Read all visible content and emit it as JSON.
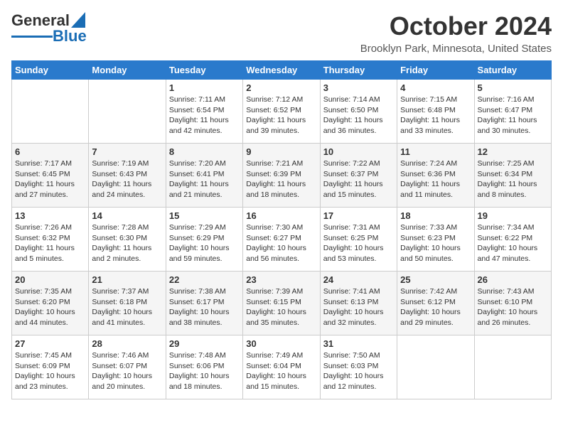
{
  "header": {
    "logo_general": "General",
    "logo_blue": "Blue",
    "month": "October 2024",
    "location": "Brooklyn Park, Minnesota, United States"
  },
  "weekdays": [
    "Sunday",
    "Monday",
    "Tuesday",
    "Wednesday",
    "Thursday",
    "Friday",
    "Saturday"
  ],
  "weeks": [
    [
      {
        "day": "",
        "info": ""
      },
      {
        "day": "",
        "info": ""
      },
      {
        "day": "1",
        "info": "Sunrise: 7:11 AM\nSunset: 6:54 PM\nDaylight: 11 hours and 42 minutes."
      },
      {
        "day": "2",
        "info": "Sunrise: 7:12 AM\nSunset: 6:52 PM\nDaylight: 11 hours and 39 minutes."
      },
      {
        "day": "3",
        "info": "Sunrise: 7:14 AM\nSunset: 6:50 PM\nDaylight: 11 hours and 36 minutes."
      },
      {
        "day": "4",
        "info": "Sunrise: 7:15 AM\nSunset: 6:48 PM\nDaylight: 11 hours and 33 minutes."
      },
      {
        "day": "5",
        "info": "Sunrise: 7:16 AM\nSunset: 6:47 PM\nDaylight: 11 hours and 30 minutes."
      }
    ],
    [
      {
        "day": "6",
        "info": "Sunrise: 7:17 AM\nSunset: 6:45 PM\nDaylight: 11 hours and 27 minutes."
      },
      {
        "day": "7",
        "info": "Sunrise: 7:19 AM\nSunset: 6:43 PM\nDaylight: 11 hours and 24 minutes."
      },
      {
        "day": "8",
        "info": "Sunrise: 7:20 AM\nSunset: 6:41 PM\nDaylight: 11 hours and 21 minutes."
      },
      {
        "day": "9",
        "info": "Sunrise: 7:21 AM\nSunset: 6:39 PM\nDaylight: 11 hours and 18 minutes."
      },
      {
        "day": "10",
        "info": "Sunrise: 7:22 AM\nSunset: 6:37 PM\nDaylight: 11 hours and 15 minutes."
      },
      {
        "day": "11",
        "info": "Sunrise: 7:24 AM\nSunset: 6:36 PM\nDaylight: 11 hours and 11 minutes."
      },
      {
        "day": "12",
        "info": "Sunrise: 7:25 AM\nSunset: 6:34 PM\nDaylight: 11 hours and 8 minutes."
      }
    ],
    [
      {
        "day": "13",
        "info": "Sunrise: 7:26 AM\nSunset: 6:32 PM\nDaylight: 11 hours and 5 minutes."
      },
      {
        "day": "14",
        "info": "Sunrise: 7:28 AM\nSunset: 6:30 PM\nDaylight: 11 hours and 2 minutes."
      },
      {
        "day": "15",
        "info": "Sunrise: 7:29 AM\nSunset: 6:29 PM\nDaylight: 10 hours and 59 minutes."
      },
      {
        "day": "16",
        "info": "Sunrise: 7:30 AM\nSunset: 6:27 PM\nDaylight: 10 hours and 56 minutes."
      },
      {
        "day": "17",
        "info": "Sunrise: 7:31 AM\nSunset: 6:25 PM\nDaylight: 10 hours and 53 minutes."
      },
      {
        "day": "18",
        "info": "Sunrise: 7:33 AM\nSunset: 6:23 PM\nDaylight: 10 hours and 50 minutes."
      },
      {
        "day": "19",
        "info": "Sunrise: 7:34 AM\nSunset: 6:22 PM\nDaylight: 10 hours and 47 minutes."
      }
    ],
    [
      {
        "day": "20",
        "info": "Sunrise: 7:35 AM\nSunset: 6:20 PM\nDaylight: 10 hours and 44 minutes."
      },
      {
        "day": "21",
        "info": "Sunrise: 7:37 AM\nSunset: 6:18 PM\nDaylight: 10 hours and 41 minutes."
      },
      {
        "day": "22",
        "info": "Sunrise: 7:38 AM\nSunset: 6:17 PM\nDaylight: 10 hours and 38 minutes."
      },
      {
        "day": "23",
        "info": "Sunrise: 7:39 AM\nSunset: 6:15 PM\nDaylight: 10 hours and 35 minutes."
      },
      {
        "day": "24",
        "info": "Sunrise: 7:41 AM\nSunset: 6:13 PM\nDaylight: 10 hours and 32 minutes."
      },
      {
        "day": "25",
        "info": "Sunrise: 7:42 AM\nSunset: 6:12 PM\nDaylight: 10 hours and 29 minutes."
      },
      {
        "day": "26",
        "info": "Sunrise: 7:43 AM\nSunset: 6:10 PM\nDaylight: 10 hours and 26 minutes."
      }
    ],
    [
      {
        "day": "27",
        "info": "Sunrise: 7:45 AM\nSunset: 6:09 PM\nDaylight: 10 hours and 23 minutes."
      },
      {
        "day": "28",
        "info": "Sunrise: 7:46 AM\nSunset: 6:07 PM\nDaylight: 10 hours and 20 minutes."
      },
      {
        "day": "29",
        "info": "Sunrise: 7:48 AM\nSunset: 6:06 PM\nDaylight: 10 hours and 18 minutes."
      },
      {
        "day": "30",
        "info": "Sunrise: 7:49 AM\nSunset: 6:04 PM\nDaylight: 10 hours and 15 minutes."
      },
      {
        "day": "31",
        "info": "Sunrise: 7:50 AM\nSunset: 6:03 PM\nDaylight: 10 hours and 12 minutes."
      },
      {
        "day": "",
        "info": ""
      },
      {
        "day": "",
        "info": ""
      }
    ]
  ]
}
